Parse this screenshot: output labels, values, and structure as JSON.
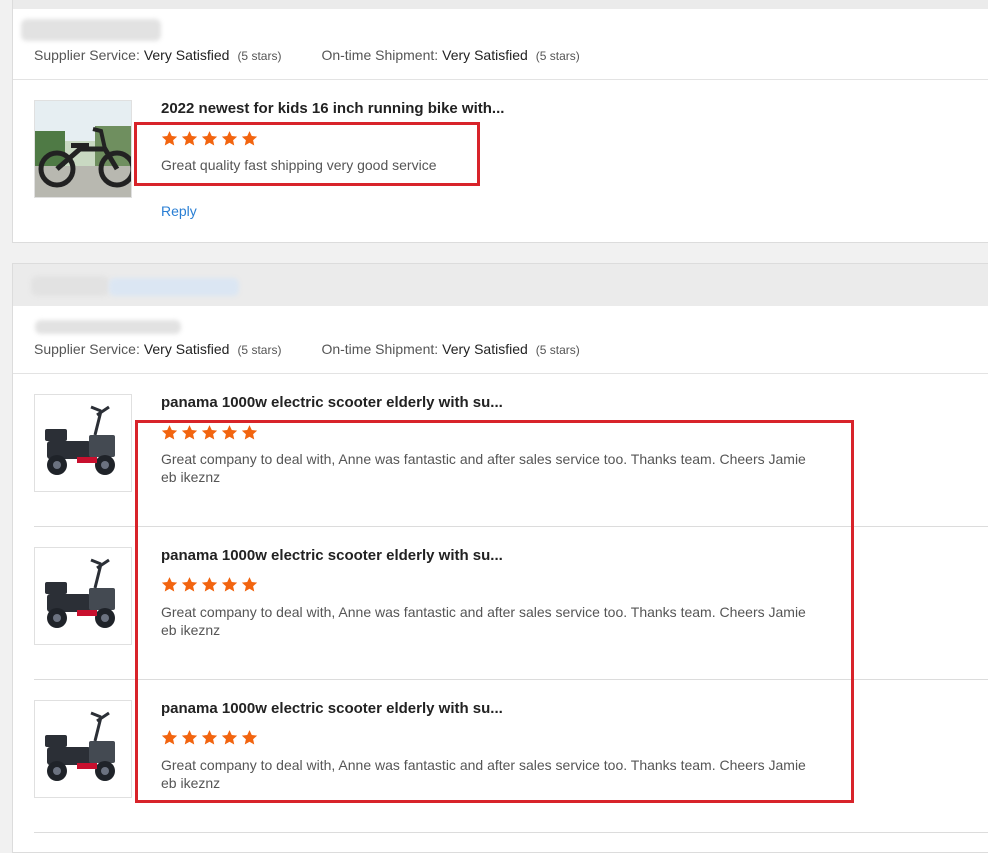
{
  "ratings": {
    "supplier_label": "Supplier Service:",
    "supplier_value": "Very Satisfied",
    "supplier_stars": "(5 stars)",
    "shipment_label": "On-time Shipment:",
    "shipment_value": "Very Satisfied",
    "shipment_stars": "(5 stars)"
  },
  "review1": {
    "title": "2022 newest for kids 16 inch running bike with...",
    "rating": 5,
    "text": "Great quality fast shipping very good service",
    "reply": "Reply"
  },
  "review2": {
    "items": [
      {
        "title": "panama 1000w electric scooter elderly with su...",
        "rating": 5,
        "text": "Great company to deal with, Anne was fantastic and after sales service too. Thanks team. Cheers Jamie eb ikeznz"
      },
      {
        "title": "panama 1000w electric scooter elderly with su...",
        "rating": 5,
        "text": "Great company to deal with, Anne was fantastic and after sales service too. Thanks team. Cheers Jamie eb ikeznz"
      },
      {
        "title": "panama 1000w electric scooter elderly with su...",
        "rating": 5,
        "text": "Great company to deal with, Anne was fantastic and after sales service too. Thanks team. Cheers Jamie eb ikeznz"
      }
    ]
  },
  "colors": {
    "star": "#f2640f",
    "highlight": "#d8232a",
    "link": "#2a7fd4"
  },
  "icons": {
    "star": "star-icon",
    "bike": "kids-balance-bike-image",
    "scooter": "electric-scooter-image"
  }
}
